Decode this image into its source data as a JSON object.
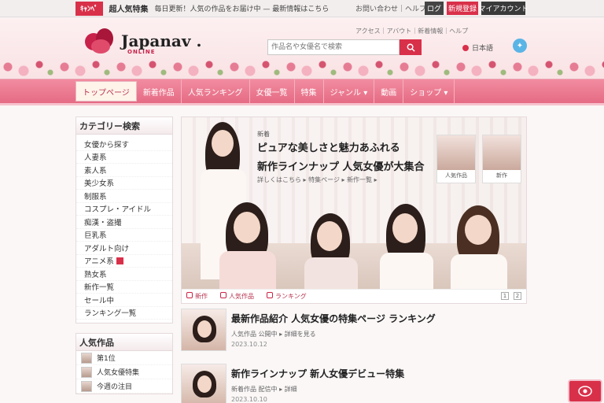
{
  "topbar": {
    "promo_badge": "ｷｬﾝﾍﾟ",
    "promo_text": "超人気特集",
    "promo_sub": "毎日更新！人気の作品をお届け中 — 最新情報はこちら",
    "right_link": "お問い合わせ｜ヘルプ",
    "login_label": "ログ",
    "register_label": "新規登録",
    "account_label": "マイアカウント"
  },
  "header": {
    "logo_text": "Japanav .",
    "logo_sub": "ONLINE",
    "mini_links": "アクセス｜アバウト｜新着情報｜ヘルプ",
    "search_placeholder": "作品名や女優名で検索",
    "language": "日本語",
    "social_icon": "twitter-icon"
  },
  "nav": {
    "tabs": [
      {
        "label": "トップページ",
        "active": true
      },
      {
        "label": "新着作品",
        "active": false
      },
      {
        "label": "人気ランキング",
        "active": false
      },
      {
        "label": "女優一覧",
        "active": false
      },
      {
        "label": "特集",
        "active": false
      },
      {
        "label": "ジャンル ▾",
        "active": false
      },
      {
        "label": "動画",
        "active": false
      },
      {
        "label": "ショップ ▾",
        "active": false
      }
    ]
  },
  "sidebar": {
    "categories_title": "カテゴリー検索",
    "categories": [
      "女優から探す",
      "人妻系",
      "素人系",
      "美少女系",
      "制服系",
      "コスプレ・アイドル",
      "痴漢・盗撮",
      "巨乳系",
      "アダルト向け",
      "アニメ系",
      "熟女系",
      "新作一覧",
      "セール中",
      "ランキング一覧"
    ],
    "hot_index": 9,
    "ranking_title": "人気作品",
    "ranking_items": [
      "第1位",
      "人気女優特集",
      "今週の注目"
    ]
  },
  "hero": {
    "kicker": "新着",
    "headline": "ピュアな美しさと魅力あふれる",
    "headline2": "新作ラインナップ 人気女優が大集合",
    "sub": "詳しくはこちら ▸ 特集ページ ▸ 新作一覧 ▸",
    "thumb1_caption": "人気作品",
    "thumb2_caption": "新作",
    "strip_items": [
      "新作",
      "人気作品",
      "ランキング"
    ],
    "pager": [
      "1",
      "2"
    ]
  },
  "articles": [
    {
      "title": "最新作品紹介 人気女優の特集ページ ランキング",
      "meta": "人気作品 公開中 ▸ 詳細を見る",
      "meta2": "2023.10.12"
    },
    {
      "title": "新作ラインナップ 新人女優デビュー特集",
      "meta": "新着作品 配信中 ▸ 詳細",
      "meta2": "2023.10.10"
    }
  ],
  "colors": {
    "accent": "#d9304a",
    "nav_pink": "#e56b84",
    "header_bg": "#fdf0f1"
  }
}
